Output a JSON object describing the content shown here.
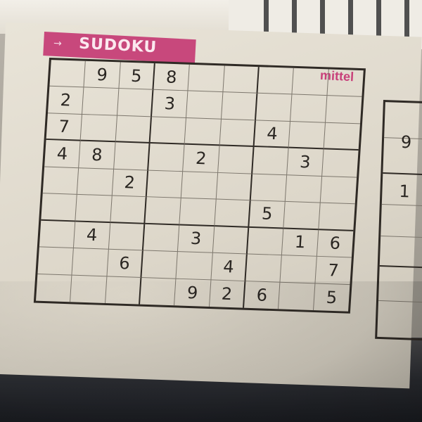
{
  "header": {
    "arrow": "→",
    "title": "SUDOKU"
  },
  "difficulty": "mittel",
  "grid": [
    [
      "",
      "9",
      "5",
      "8",
      "",
      "",
      "",
      "",
      ""
    ],
    [
      "2",
      "",
      "",
      "3",
      "",
      "",
      "",
      "",
      ""
    ],
    [
      "7",
      "",
      "",
      "",
      "",
      "",
      "4",
      "",
      ""
    ],
    [
      "4",
      "8",
      "",
      "",
      "2",
      "",
      "",
      "3",
      ""
    ],
    [
      "",
      "",
      "2",
      "",
      "",
      "",
      "",
      "",
      ""
    ],
    [
      "",
      "",
      "",
      "",
      "",
      "",
      "5",
      "",
      ""
    ],
    [
      "",
      "4",
      "",
      "",
      "3",
      "",
      "",
      "1",
      "6"
    ],
    [
      "",
      "",
      "6",
      "",
      "",
      "4",
      "",
      "",
      "7"
    ],
    [
      "",
      "",
      "",
      "",
      "9",
      "2",
      "6",
      "",
      "5"
    ]
  ],
  "side_grid_digits": [
    "9",
    "1"
  ],
  "colors": {
    "header_pink": "#c8487c",
    "difficulty_pink": "#c8407a",
    "paper": "#e9e4d8",
    "ink": "#2a2622"
  }
}
